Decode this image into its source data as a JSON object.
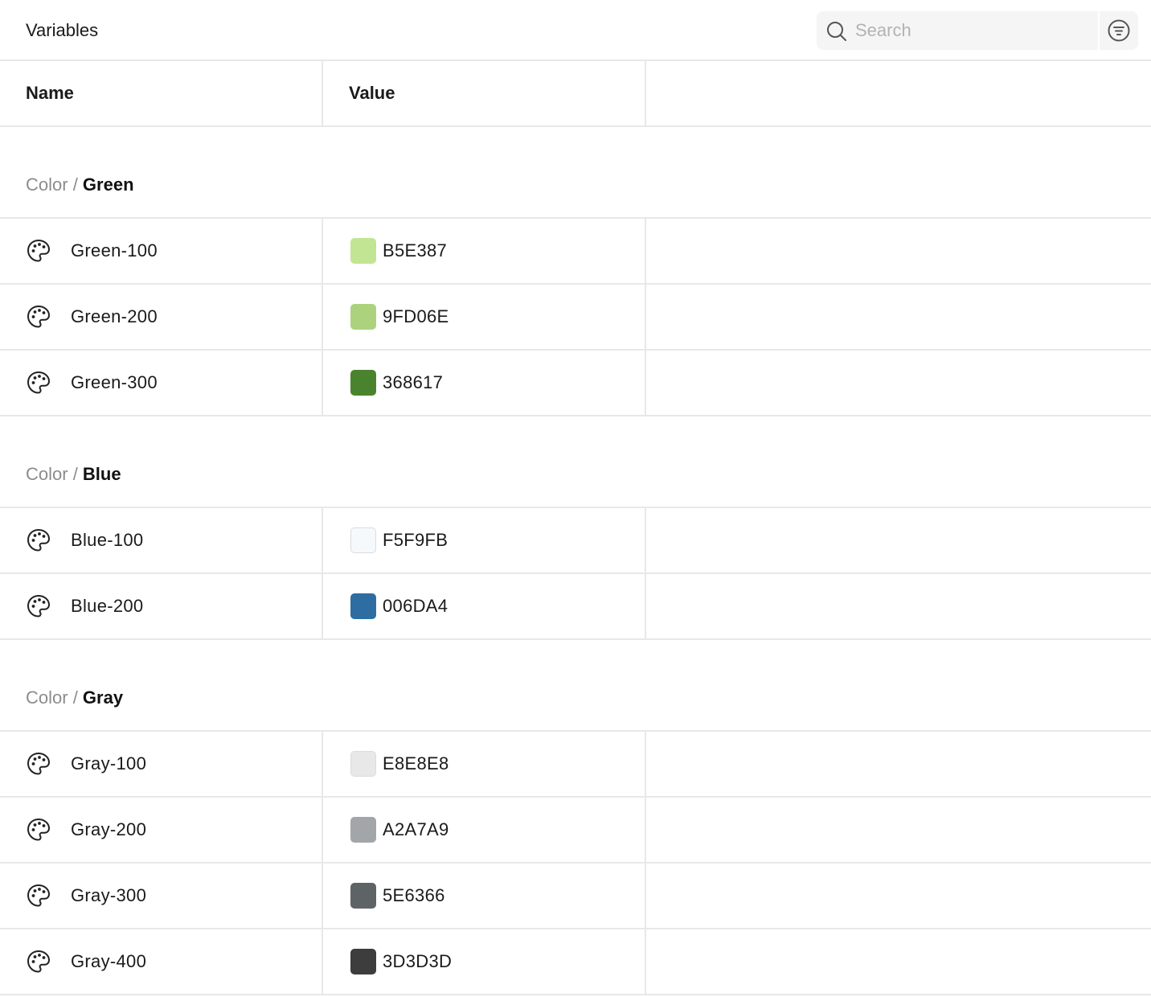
{
  "header": {
    "title": "Variables",
    "search_placeholder": "Search",
    "search_value": ""
  },
  "columns": {
    "name": "Name",
    "value": "Value"
  },
  "groups": [
    {
      "path": "Color",
      "separator": " / ",
      "name": "Green",
      "rows": [
        {
          "name": "Green-100",
          "hex": "B5E387",
          "color": "#C2E593"
        },
        {
          "name": "Green-200",
          "hex": "9FD06E",
          "color": "#ADD27D"
        },
        {
          "name": "Green-300",
          "hex": "368617",
          "color": "#4A832D"
        }
      ]
    },
    {
      "path": "Color",
      "separator": " / ",
      "name": "Blue",
      "rows": [
        {
          "name": "Blue-100",
          "hex": "F5F9FB",
          "color": "#F5F9FB"
        },
        {
          "name": "Blue-200",
          "hex": "006DA4",
          "color": "#2E6DA1"
        }
      ]
    },
    {
      "path": "Color",
      "separator": " / ",
      "name": "Gray",
      "rows": [
        {
          "name": "Gray-100",
          "hex": "E8E8E8",
          "color": "#E8E8E8"
        },
        {
          "name": "Gray-200",
          "hex": "A2A7A9",
          "color": "#A3A6A8"
        },
        {
          "name": "Gray-300",
          "hex": "5E6366",
          "color": "#5E6366"
        },
        {
          "name": "Gray-400",
          "hex": "3D3D3D",
          "color": "#3D3D3D"
        }
      ]
    }
  ],
  "icons": {
    "search": "search-icon",
    "filter": "filter-icon",
    "palette": "palette-icon"
  },
  "colors": {
    "divider": "#E8E8E8",
    "search_bg": "#F5F5F5",
    "muted_text": "#8C8C8C"
  }
}
